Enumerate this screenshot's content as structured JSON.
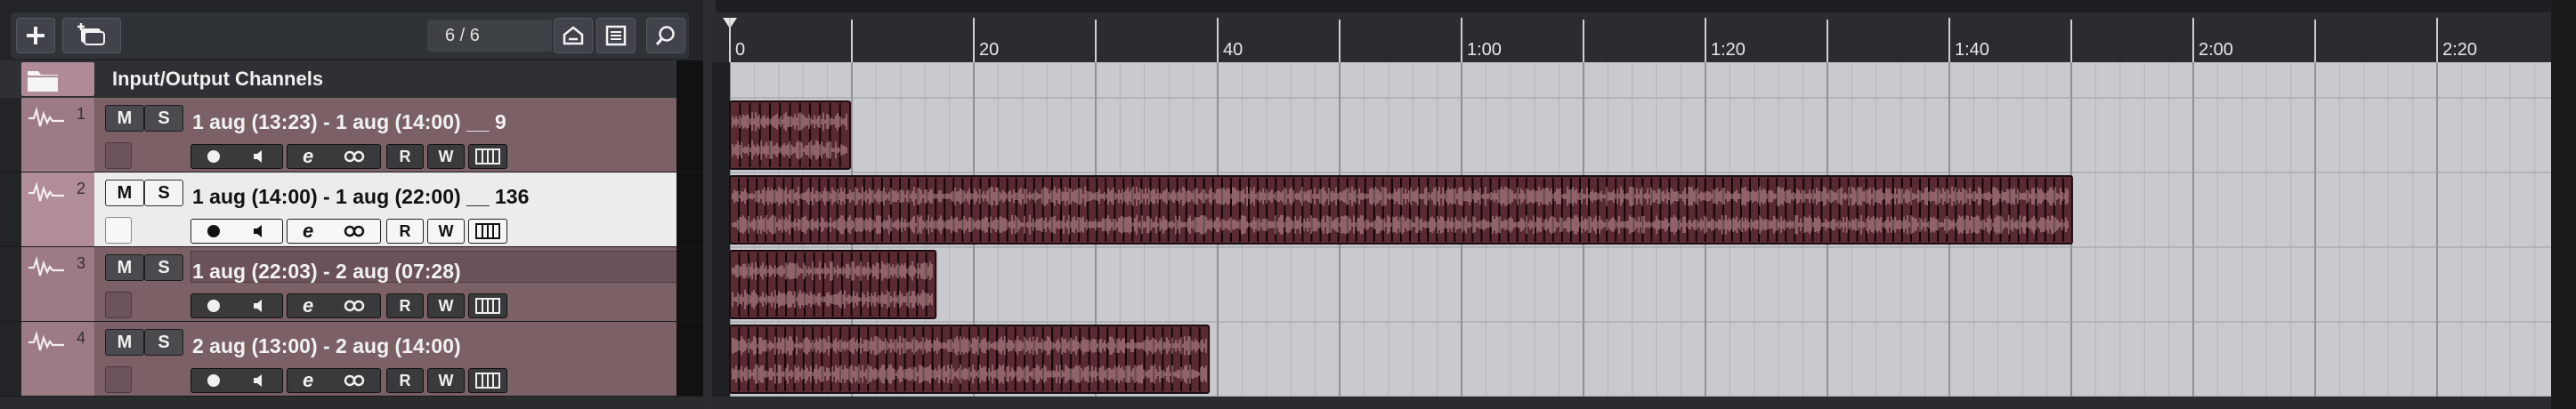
{
  "toolbar": {
    "add_track_icon": "plus-icon",
    "add_folder_icon": "add-track-from-preset-icon",
    "track_counter": "6 / 6",
    "visibility_icon": "house-icon",
    "list_icon": "list-icon",
    "search_icon": "search-icon"
  },
  "header": {
    "title": "Input/Output Channels",
    "folder_icon": "folder-icon"
  },
  "tracks": [
    {
      "number": "1",
      "name": "1 aug (13:23) - 1 aug (14:00) __ 9",
      "mute": "M",
      "solo": "S",
      "read": "R",
      "write": "W",
      "edit": "e",
      "selected": false,
      "clip_end": 0.066,
      "dense": 12
    },
    {
      "number": "2",
      "name": "1 aug (14:00) - 1 aug (22:00) __ 136",
      "mute": "M",
      "solo": "S",
      "read": "R",
      "write": "W",
      "edit": "e",
      "selected": true,
      "clip_end": 0.737,
      "dense": 150
    },
    {
      "number": "3",
      "name": "1 aug (22:03) - 2 aug (07:28)",
      "mute": "M",
      "solo": "S",
      "read": "R",
      "write": "W",
      "edit": "e",
      "selected": false,
      "clip_end": 0.113,
      "dense": 22
    },
    {
      "number": "4",
      "name": "2 aug (13:00) - 2 aug (14:00)",
      "mute": "M",
      "solo": "S",
      "read": "R",
      "write": "W",
      "edit": "e",
      "selected": false,
      "clip_end": 0.263,
      "dense": 52
    }
  ],
  "ruler": {
    "labels": [
      "0",
      "20",
      "40",
      "1:00",
      "1:20",
      "1:40",
      "2:00",
      "2:20"
    ],
    "seconds_per_label": 20,
    "total_seconds": 151
  },
  "colors": {
    "clip_fill": "#5a2a32",
    "clip_wave": "#e3b8bf",
    "track_body": "#7b6066",
    "track_side": "#9d7b85",
    "selected_body": "#ececec"
  }
}
